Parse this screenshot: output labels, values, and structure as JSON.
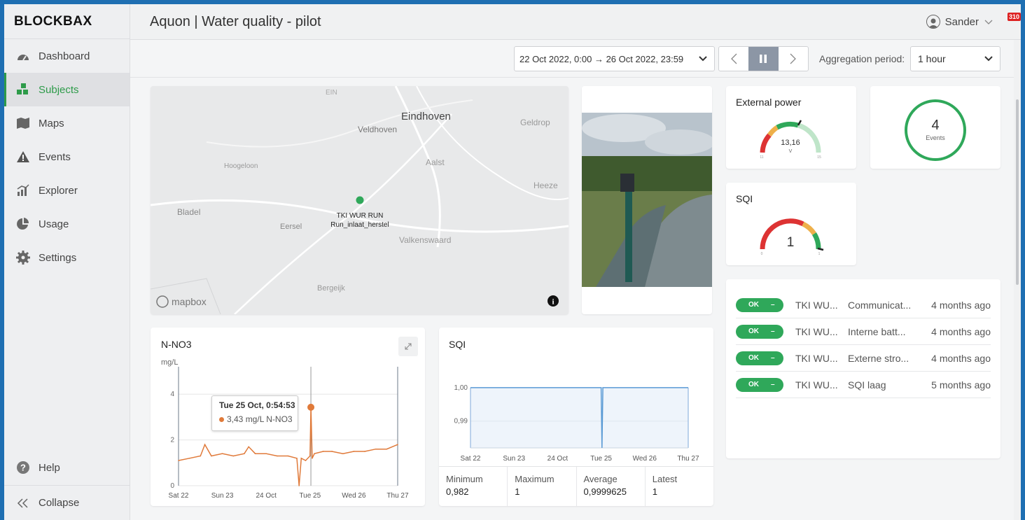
{
  "app": {
    "logo": "BLOCKBAX"
  },
  "sidebar": {
    "items": [
      {
        "label": "Dashboard",
        "icon": "gauge-icon"
      },
      {
        "label": "Subjects",
        "icon": "cubes-icon"
      },
      {
        "label": "Maps",
        "icon": "map-icon"
      },
      {
        "label": "Events",
        "icon": "warning-icon"
      },
      {
        "label": "Explorer",
        "icon": "chart-icon"
      },
      {
        "label": "Usage",
        "icon": "pie-icon"
      },
      {
        "label": "Settings",
        "icon": "gear-icon"
      }
    ],
    "help_label": "Help",
    "collapse_label": "Collapse",
    "active": "Subjects"
  },
  "header": {
    "title": "Aquon | Water quality - pilot",
    "user": "Sander",
    "notification_count": "310"
  },
  "toolbar": {
    "date_range": "22 Oct 2022, 0:00 → 26 Oct 2022, 23:59",
    "agg_label": "Aggregation period:",
    "agg_value": "1 hour"
  },
  "map": {
    "places": [
      "EIN",
      "Eindhoven",
      "Veldhoven",
      "Geldrop",
      "Hoogeloon",
      "Aalst",
      "Heeze",
      "Bladel",
      "Eersel",
      "Valkenswaard",
      "Bergeijk"
    ],
    "marker_line1": "TKI WUR RUN",
    "marker_line2": "Run_inlaat_herstel",
    "attribution": "mapbox",
    "info": "i"
  },
  "ext_power": {
    "title": "External power",
    "value": "13,16",
    "unit": "V",
    "min": "11",
    "max": "15",
    "level": 0.54
  },
  "events_widget": {
    "count": "4",
    "label": "Events"
  },
  "sqi_gauge": {
    "title": "SQI",
    "value": "1",
    "min": "0",
    "max": "1",
    "level": 1.0
  },
  "event_list": [
    {
      "status": "OK",
      "dash": "–",
      "subject": "TKI WU...",
      "type": "Communicat...",
      "time": "4 months ago"
    },
    {
      "status": "OK",
      "dash": "–",
      "subject": "TKI WU...",
      "type": "Interne batt...",
      "time": "4 months ago"
    },
    {
      "status": "OK",
      "dash": "–",
      "subject": "TKI WU...",
      "type": "Externe stro...",
      "time": "4 months ago"
    },
    {
      "status": "OK",
      "dash": "–",
      "subject": "TKI WU...",
      "type": "SQI laag",
      "time": "5 months ago"
    }
  ],
  "nno3": {
    "title": "N-NO3",
    "tooltip_title": "Tue 25 Oct, 0:54:53",
    "tooltip_value": "3,43 mg/L N-NO3"
  },
  "sqi_chart": {
    "title": "SQI",
    "stats": [
      {
        "label": "Minimum",
        "value": "0,982"
      },
      {
        "label": "Maximum",
        "value": "1"
      },
      {
        "label": "Average",
        "value": "0,9999625"
      },
      {
        "label": "Latest",
        "value": "1"
      }
    ]
  },
  "chart_data": [
    {
      "type": "line",
      "ylabel": "mg/L",
      "yticks": [
        "0",
        "2",
        "4"
      ],
      "ylim": [
        0,
        5.2
      ],
      "xticks": [
        "Sat 22",
        "Sun 23",
        "24 Oct",
        "Tue 25",
        "Wed 26",
        "Thu 27"
      ],
      "x_days": [
        0,
        1,
        2,
        3,
        4,
        5
      ],
      "series": [
        {
          "name": "N-NO3",
          "color": "#e07a3a",
          "x": [
            0,
            0.25,
            0.5,
            0.6,
            0.75,
            1.0,
            1.25,
            1.5,
            1.6,
            1.75,
            2.0,
            2.25,
            2.5,
            2.7,
            2.75,
            2.8,
            2.9,
            3.0,
            3.02,
            3.05,
            3.1,
            3.3,
            3.5,
            3.75,
            4.0,
            4.25,
            4.5,
            4.75,
            5.0
          ],
          "y": [
            1.1,
            1.2,
            1.3,
            1.8,
            1.3,
            1.4,
            1.3,
            1.4,
            1.7,
            1.4,
            1.4,
            1.3,
            1.3,
            1.2,
            0.0,
            1.2,
            1.1,
            1.3,
            3.43,
            1.2,
            1.4,
            1.5,
            1.5,
            1.4,
            1.5,
            1.5,
            1.6,
            1.6,
            1.8
          ]
        }
      ],
      "highlight": {
        "x": 3.02,
        "y": 3.43
      },
      "grid": true
    },
    {
      "type": "area",
      "yticks": [
        "0,99",
        "1,00"
      ],
      "ylim": [
        0.982,
        1.005
      ],
      "xticks": [
        "Sat 22",
        "Sun 23",
        "24 Oct",
        "Tue 25",
        "Wed 26",
        "Thu 27"
      ],
      "x_days": [
        0,
        1,
        2,
        3,
        4,
        5
      ],
      "series": [
        {
          "name": "SQI",
          "color": "#5b9bd5",
          "x": [
            0,
            3.0,
            3.02,
            3.04,
            5.0
          ],
          "y": [
            1.0,
            1.0,
            0.982,
            1.0,
            1.0
          ]
        }
      ],
      "grid": true
    }
  ]
}
